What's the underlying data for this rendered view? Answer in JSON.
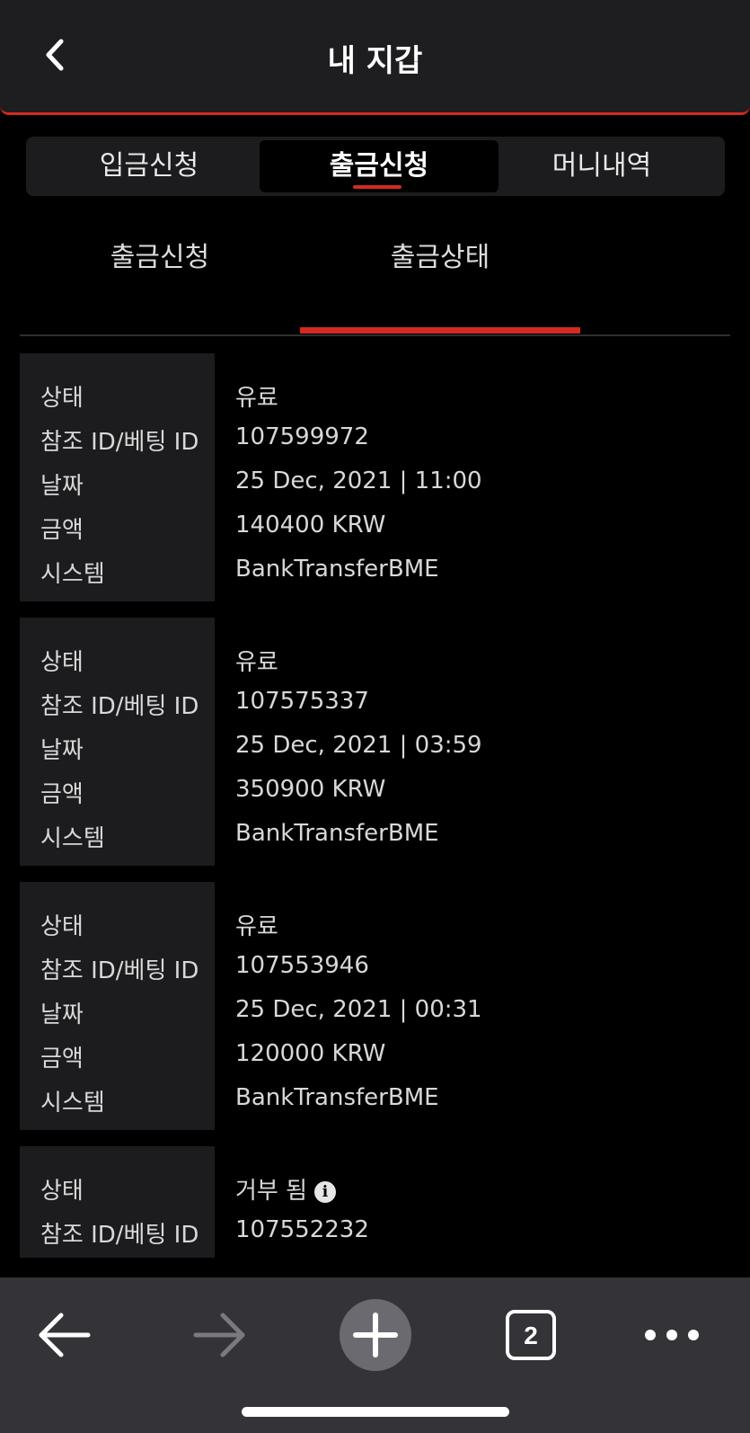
{
  "header": {
    "title": "내 지갑"
  },
  "segments": [
    {
      "label": "입금신청",
      "active": false
    },
    {
      "label": "출금신청",
      "active": true
    },
    {
      "label": "머니내역",
      "active": false
    }
  ],
  "subtabs": [
    {
      "label": "출금신청",
      "active": false
    },
    {
      "label": "출금상태",
      "active": true
    }
  ],
  "field_labels": {
    "status": "상태",
    "ref": "참조 ID/베팅 ID",
    "date": "날짜",
    "amount": "금액",
    "system": "시스템"
  },
  "transactions": [
    {
      "status": "유료",
      "ref": "107599972",
      "date": "25 Dec, 2021 | 11:00",
      "amount": "140400 KRW",
      "system": "BankTransferBME"
    },
    {
      "status": "유료",
      "ref": "107575337",
      "date": "25 Dec, 2021 | 03:59",
      "amount": "350900 KRW",
      "system": "BankTransferBME"
    },
    {
      "status": "유료",
      "ref": "107553946",
      "date": "25 Dec, 2021 | 00:31",
      "amount": "120000 KRW",
      "system": "BankTransferBME"
    },
    {
      "status": "거부 됨",
      "ref": "107552232"
    }
  ],
  "bottom_nav": {
    "tab_count": "2"
  },
  "colors": {
    "accent": "#d32a22",
    "background": "#000000",
    "panel": "#1c1c1e",
    "toolbar": "#343438"
  }
}
